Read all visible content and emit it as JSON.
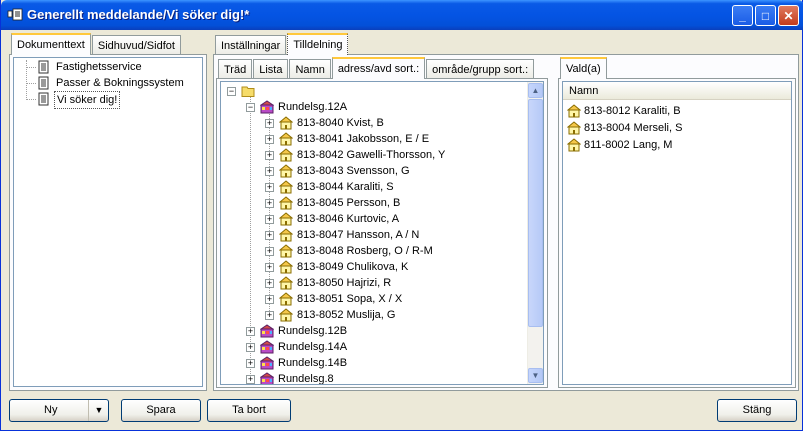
{
  "window": {
    "title": "Generellt meddelande/Vi söker dig!*",
    "minimize": "_",
    "maximize": "□",
    "close": "✕"
  },
  "left_tabs": [
    "Dokumenttext",
    "Sidhuvud/Sidfot"
  ],
  "left_list": [
    {
      "label": "Fastighetsservice"
    },
    {
      "label": "Passer & Bokningssystem"
    },
    {
      "label": "Vi söker dig!"
    }
  ],
  "top_tabs": [
    "Inställningar",
    "Tilldelning"
  ],
  "sub_tabs": [
    "Träd",
    "Lista",
    "Namn",
    "adress/avd sort.:",
    "område/grupp sort.:"
  ],
  "tree": {
    "expand_symbol": "+",
    "collapse_symbol": "−",
    "groups": [
      {
        "label": "Rundelsg.12A",
        "children": [
          "813-8040 Kvist, B",
          "813-8041 Jakobsson, E / E",
          "813-8042 Gawelli-Thorsson, Y",
          "813-8043 Svensson, G",
          "813-8044 Karaliti, S",
          "813-8045 Persson, B",
          "813-8046 Kurtovic, A",
          "813-8047 Hansson, A / N",
          "813-8048 Rosberg, O / R-M",
          "813-8049 Chulikova, K",
          "813-8050 Hajrizi, R",
          "813-8051 Sopa, X / X",
          "813-8052 Muslija, G"
        ]
      },
      {
        "label": "Rundelsg.12B"
      },
      {
        "label": "Rundelsg.14A"
      },
      {
        "label": "Rundelsg.14B"
      },
      {
        "label": "Rundelsg.8"
      }
    ]
  },
  "selected_tab": "Vald(a)",
  "selected_header": "Namn",
  "selected_items": [
    "813-8012 Karaliti, B",
    "813-8004 Merseli, S",
    "811-8002 Lang, M"
  ],
  "buttons": {
    "new": "Ny",
    "dropdown": "▼",
    "save": "Spara",
    "remove": "Ta bort",
    "close": "Stäng"
  },
  "scroll": {
    "up": "▲",
    "down": "▼"
  },
  "icons": {
    "app": "app-icon",
    "document": "document-icon",
    "folder": "folder-icon",
    "building": "building-icon",
    "house": "house-icon"
  }
}
